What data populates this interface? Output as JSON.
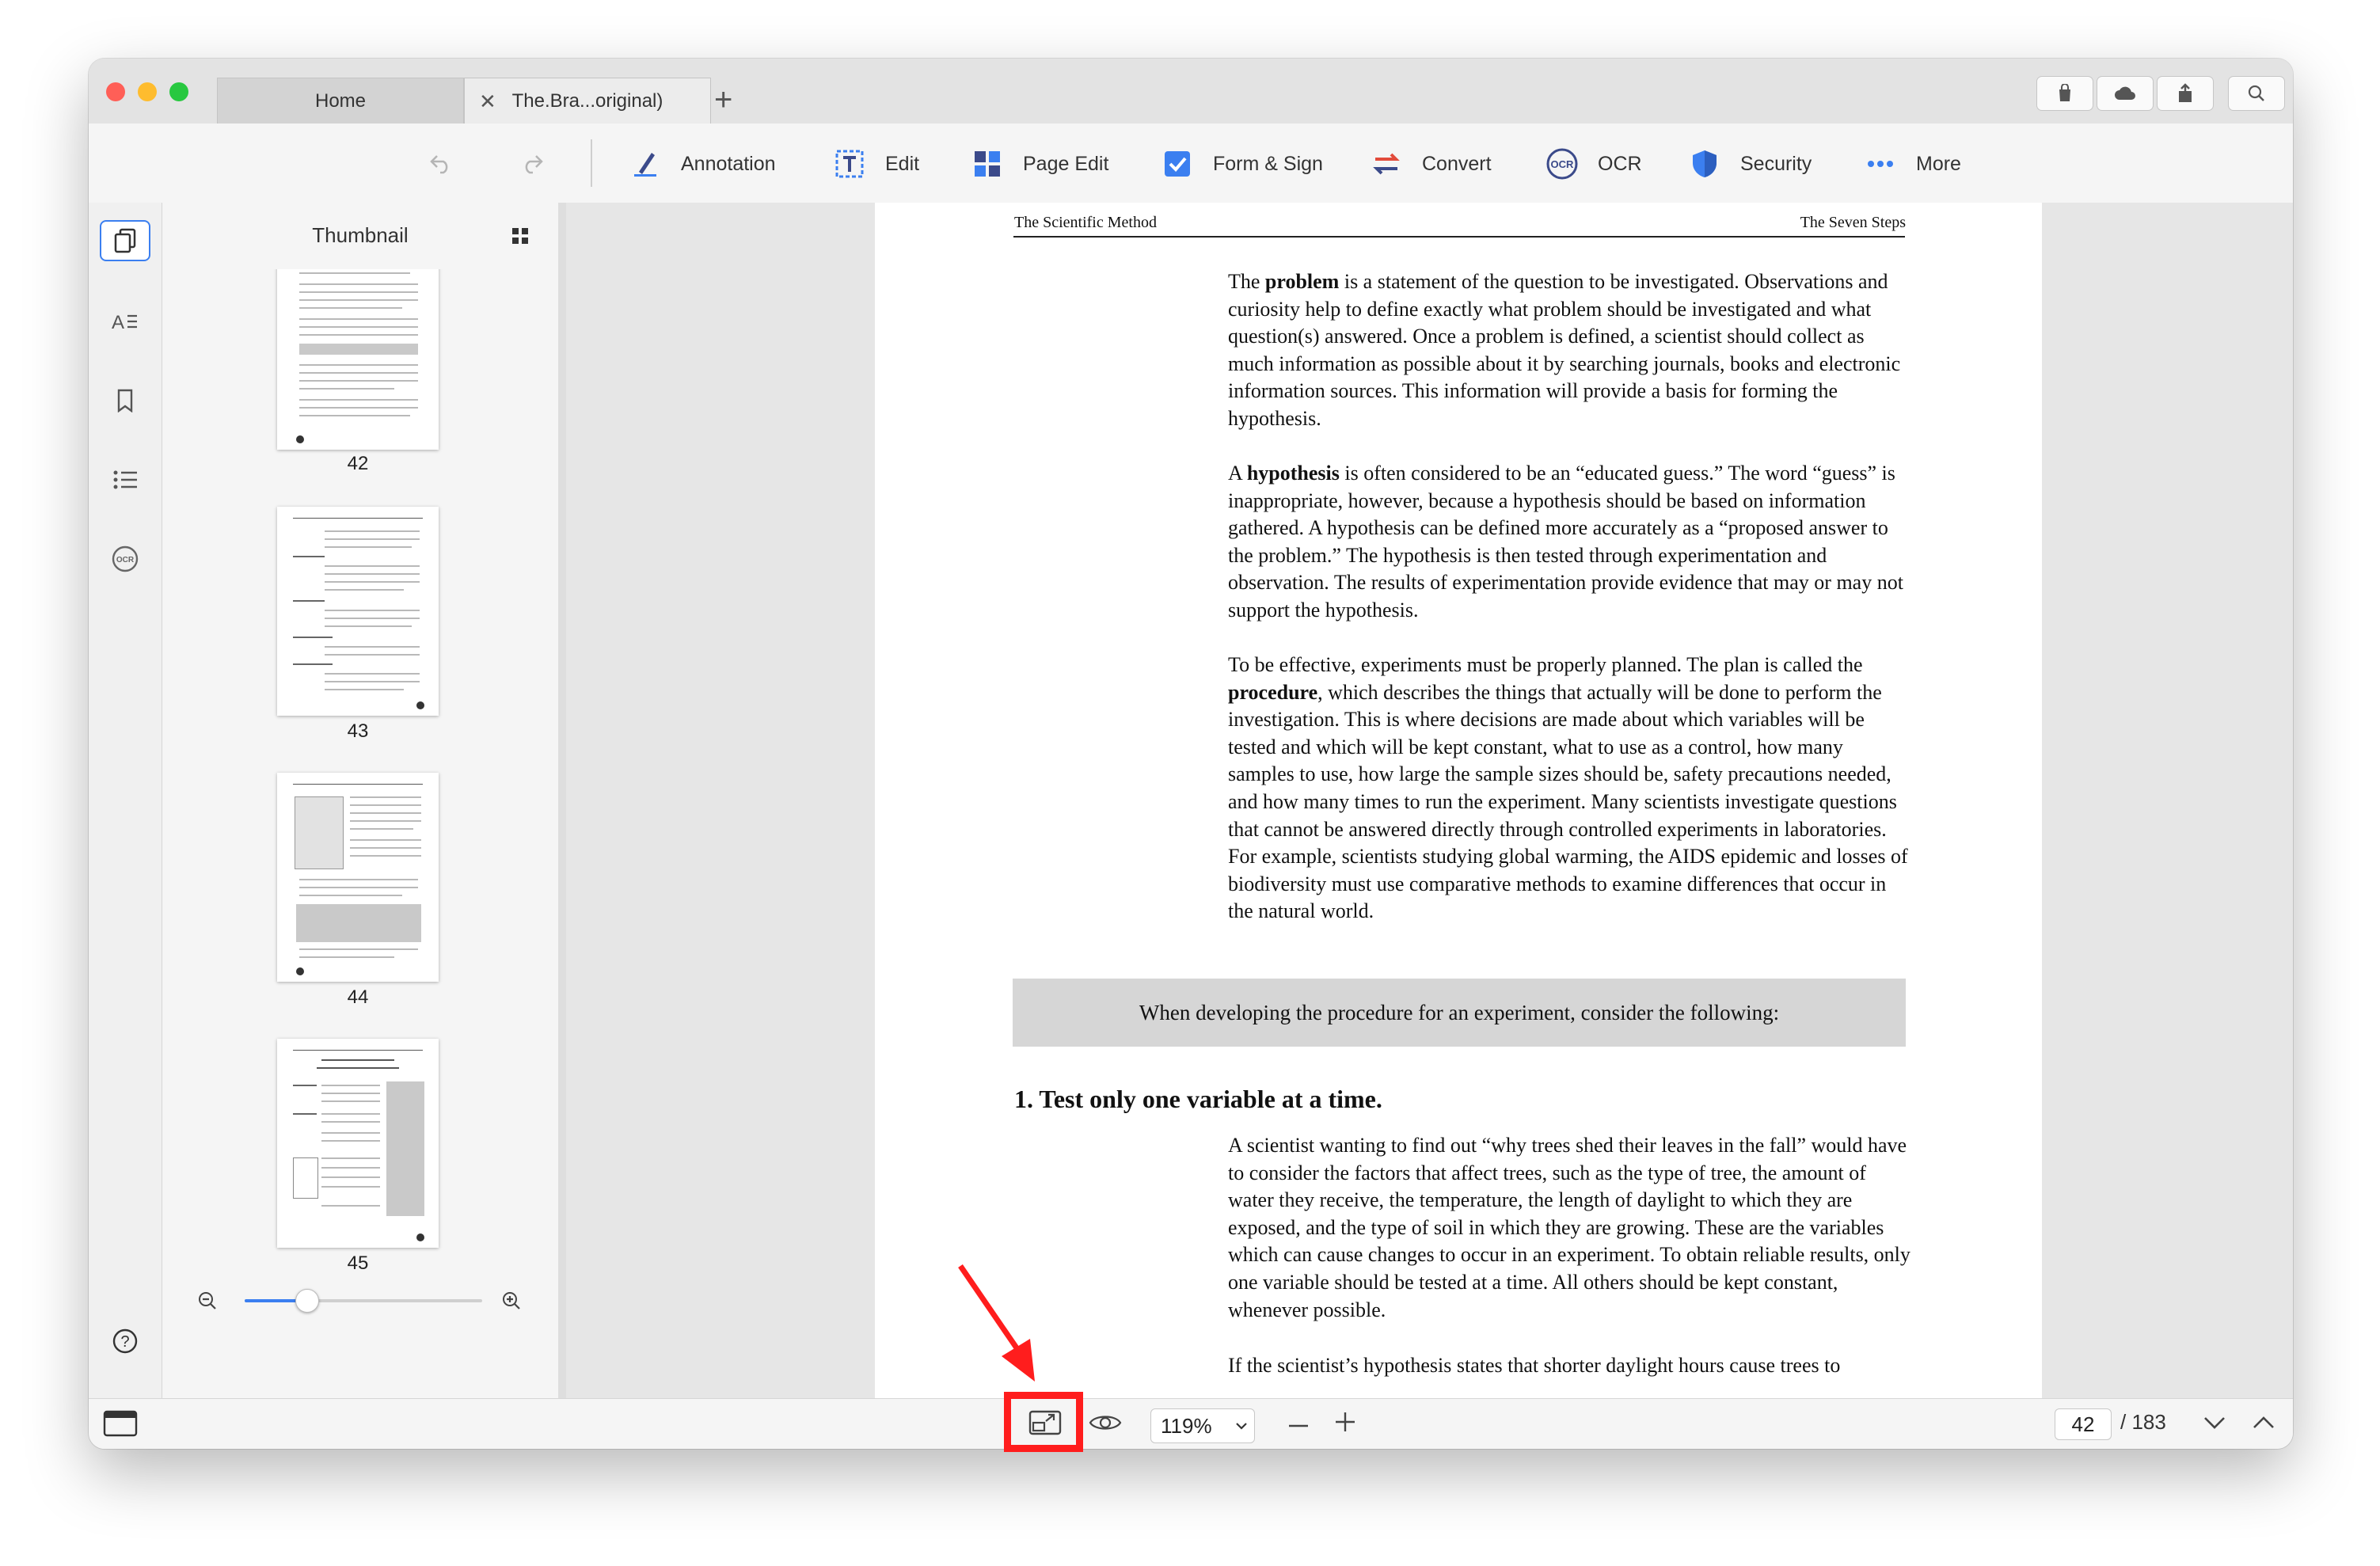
{
  "tabs": [
    {
      "label": "Home"
    },
    {
      "label": "The.Bra...original)"
    }
  ],
  "toolbar": {
    "undo_icon": "undo-icon",
    "redo_icon": "redo-icon",
    "items": [
      {
        "label": "Annotation",
        "icon": "pen-icon"
      },
      {
        "label": "Edit",
        "icon": "text-edit-icon"
      },
      {
        "label": "Page Edit",
        "icon": "grid-icon"
      },
      {
        "label": "Form & Sign",
        "icon": "checkbox-icon"
      },
      {
        "label": "Convert",
        "icon": "convert-arrows-icon"
      },
      {
        "label": "OCR",
        "icon": "ocr-icon"
      },
      {
        "label": "Security",
        "icon": "shield-icon"
      },
      {
        "label": "More",
        "icon": "dots-icon"
      }
    ]
  },
  "thumbnail_panel": {
    "title": "Thumbnail",
    "pages": [
      "42",
      "43",
      "44",
      "45"
    ]
  },
  "document": {
    "header_left": "The Scientific Method",
    "header_right": "The Seven Steps",
    "p1_a": "The ",
    "p1_bold": "problem",
    "p1_b": " is a statement of the question to be investigated. Observations and curiosity help to define exactly what problem should be investigated and what question(s) answered. Once a problem is defined, a scientist should collect as much information as possible about it by searching journals, books and electronic information sources. This information will provide a basis for forming the hypothesis.",
    "p2_a": "A ",
    "p2_bold": "hypothesis",
    "p2_b": " is often considered to be an “educated guess.” The word “guess” is inappropriate, however, because a hypothesis should be based on information gathered. A hypothesis can be defined more accurately as a “proposed answer to the problem.” The hypothesis is then tested through experimentation and observation. The results of experimentation provide evidence that may or may not support the hypothesis.",
    "p3_a": "To be effective, experiments must be properly planned. The plan is called the ",
    "p3_bold": "procedure",
    "p3_b": ", which describes the things that actually will be done to perform the investigation. This is where decisions are made about which variables will be tested and which will be kept constant, what to use as a control, how many samples to use, how large the sample sizes should be, safety precautions needed, and how many times to run the experiment. Many scientists investigate questions that cannot be answered directly through controlled experiments in laboratories. For example, scientists studying global warming, the AIDS epidemic and losses of biodiversity must use comparative methods to examine differences that occur in the natural world.",
    "callout": "When developing the procedure for an experiment, consider the following:",
    "heading1": "1.  Test only one variable at a time.",
    "p4": "A scientist wanting to find out “why trees shed their leaves in the fall” would have to consider the factors that affect trees, such as the type of tree, the amount of water they receive, the temperature, the length of daylight to which they are exposed, and the type of soil in which they are growing. These are the variables which can cause changes to occur in an experiment. To obtain reliable results, only one variable should be tested at a time. All others should be kept constant, whenever possible.",
    "p5": "If the scientist’s hypothesis states that shorter daylight hours cause trees to"
  },
  "statusbar": {
    "zoom": "119%",
    "page_current": "42",
    "page_total": "/ 183"
  },
  "colors": {
    "accent": "#3b7ff0",
    "highlight": "#ff1d1d",
    "traffic_red": "#ff5f57",
    "traffic_yellow": "#febc2e",
    "traffic_green": "#28c840"
  }
}
